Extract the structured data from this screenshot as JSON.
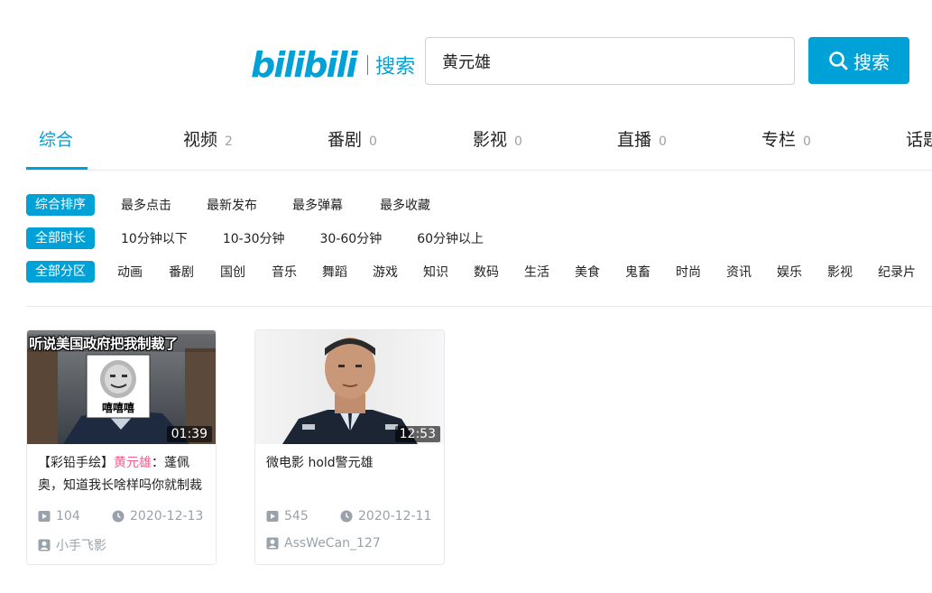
{
  "header": {
    "logo_text": "bilibili",
    "logo_sub": "搜索",
    "search_value": "黄元雄",
    "search_button": "搜索"
  },
  "tabs": [
    {
      "label": "综合",
      "count": ""
    },
    {
      "label": "视频",
      "count": "2"
    },
    {
      "label": "番剧",
      "count": "0"
    },
    {
      "label": "影视",
      "count": "0"
    },
    {
      "label": "直播",
      "count": "0"
    },
    {
      "label": "专栏",
      "count": "0"
    },
    {
      "label": "话题",
      "count": ""
    }
  ],
  "filters": {
    "order": {
      "selected": "综合排序",
      "options": [
        "最多点击",
        "最新发布",
        "最多弹幕",
        "最多收藏"
      ]
    },
    "duration": {
      "selected": "全部时长",
      "options": [
        "10分钟以下",
        "10-30分钟",
        "30-60分钟",
        "60分钟以上"
      ]
    },
    "zone": {
      "selected": "全部分区",
      "options": [
        "动画",
        "番剧",
        "国创",
        "音乐",
        "舞蹈",
        "游戏",
        "知识",
        "数码",
        "生活",
        "美食",
        "鬼畜",
        "时尚",
        "资讯",
        "娱乐",
        "影视",
        "纪录片"
      ]
    }
  },
  "videos": [
    {
      "thumb_caption": "听说美国政府把我制裁了",
      "sticker_text": "嘻嘻嘻",
      "duration": "01:39",
      "title_prefix": "【彩铅手绘】",
      "title_highlight": "黄元雄",
      "title_suffix": "：蓬佩奥，知道我长啥样吗你就制裁我？",
      "plays": "104",
      "date": "2020-12-13",
      "author": "小手飞影"
    },
    {
      "duration": "12:53",
      "title_prefix": "微电影 hold警元雄",
      "title_highlight": "",
      "title_suffix": "",
      "plays": "545",
      "date": "2020-12-11",
      "author": "AssWeCan_127"
    }
  ],
  "colors": {
    "accent": "#00a1d6",
    "highlight": "#f25d8e",
    "muted": "#99a2aa"
  }
}
